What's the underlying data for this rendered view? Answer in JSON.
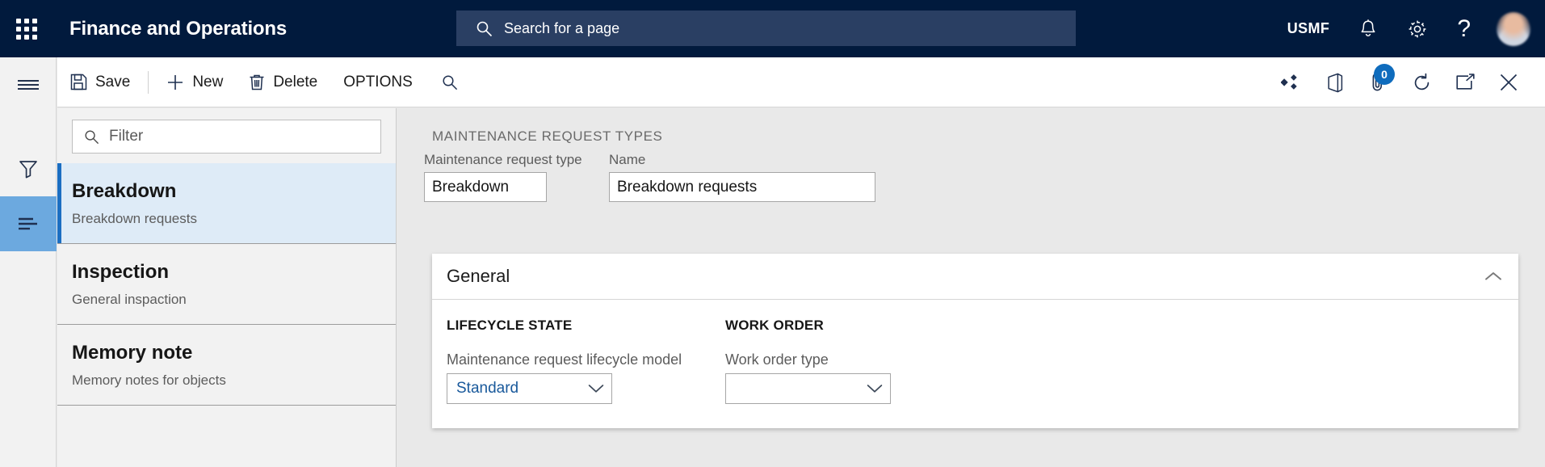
{
  "top_nav": {
    "waffle_icon": "app-launcher-waffle-icon",
    "app_title": "Finance and Operations",
    "search": {
      "icon": "search-icon",
      "placeholder": "Search for a page",
      "value": ""
    },
    "company": "USMF",
    "icons": {
      "notifications": "bell-icon",
      "settings": "gear-icon",
      "help": "question-mark-icon",
      "avatar": "user-avatar"
    }
  },
  "left_rail": {
    "items": [
      {
        "name": "hamburger-menu-icon",
        "selected": false
      },
      {
        "name": "filter-funnel-icon",
        "selected": false
      },
      {
        "name": "list-lines-icon",
        "selected": true
      }
    ]
  },
  "toolbar": {
    "buttons": [
      {
        "label": "Save",
        "icon": "save-disk-icon"
      },
      {
        "label": "New",
        "icon": "plus-icon"
      },
      {
        "label": "Delete",
        "icon": "trash-can-icon"
      },
      {
        "label": "OPTIONS",
        "icon": ""
      }
    ],
    "search_icon": "search-icon",
    "right_icons": [
      {
        "name": "relationships-diamond-icon"
      },
      {
        "name": "open-in-office-icon"
      },
      {
        "name": "attachments-paperclip-icon",
        "badge": "0"
      },
      {
        "name": "refresh-icon"
      },
      {
        "name": "open-in-new-window-icon"
      },
      {
        "name": "close-icon"
      }
    ]
  },
  "list_pane": {
    "filter": {
      "icon": "search-icon",
      "placeholder": "Filter",
      "value": ""
    },
    "items": [
      {
        "title": "Breakdown",
        "subtitle": "Breakdown requests",
        "selected": true
      },
      {
        "title": "Inspection",
        "subtitle": "General inspaction",
        "selected": false
      },
      {
        "title": "Memory note",
        "subtitle": "Memory notes for objects",
        "selected": false
      }
    ]
  },
  "main": {
    "page_caption": "MAINTENANCE REQUEST TYPES",
    "header_fields": [
      {
        "label": "Maintenance request type",
        "value": "Breakdown"
      },
      {
        "label": "Name",
        "value": "Breakdown requests"
      }
    ],
    "general_section": {
      "title": "General",
      "collapse_icon": "chevron-up-icon",
      "columns": [
        {
          "heading": "LIFECYCLE STATE",
          "field_label": "Maintenance request lifecycle model",
          "field_value": "Standard",
          "dropdown_icon": "chevron-down-icon"
        },
        {
          "heading": "WORK ORDER",
          "field_label": "Work order type",
          "field_value": "",
          "dropdown_icon": "chevron-down-icon"
        }
      ]
    }
  },
  "colors": {
    "nav_background": "#011A3D",
    "search_background": "#2A3F63",
    "accent_blue": "#1B6EC2",
    "selected_item_background": "#DEEBF7",
    "rail_selected_background": "#6CA9DF",
    "badge_blue": "#0F6CBD",
    "value_link_blue": "#19599B",
    "page_background": "#E9E9E9"
  }
}
